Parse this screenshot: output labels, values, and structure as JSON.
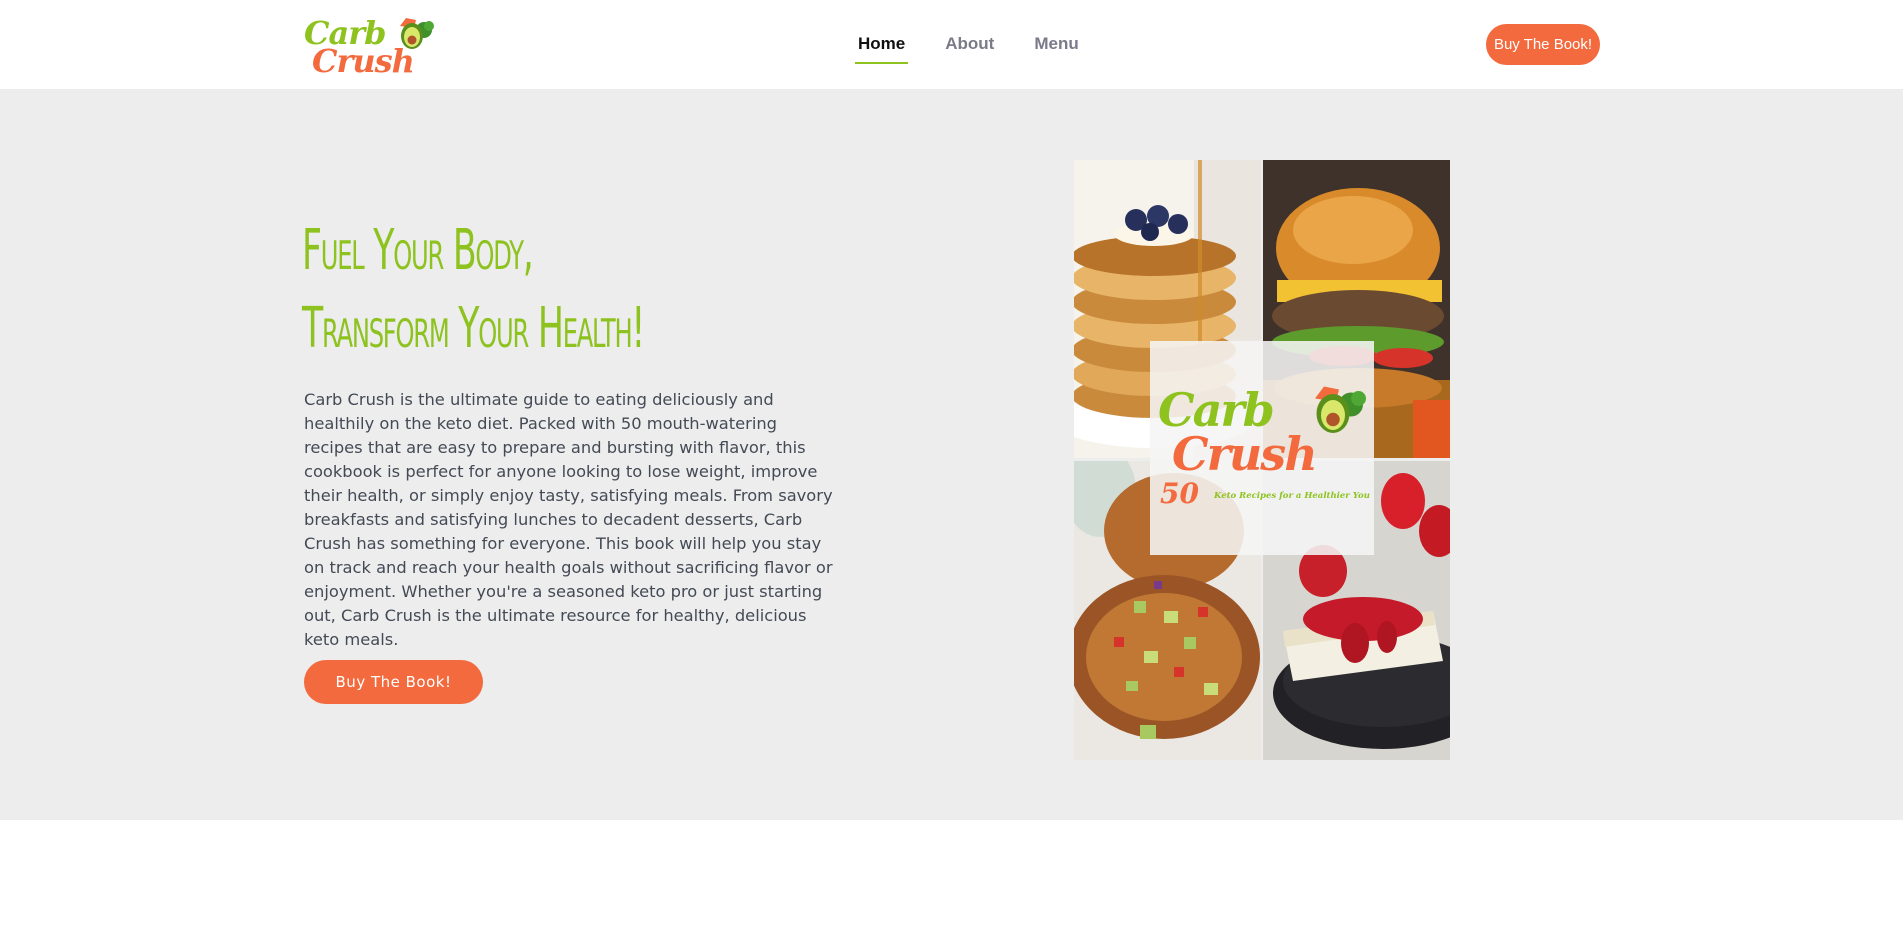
{
  "header": {
    "logo": {
      "line1": "Carb",
      "line2": "Crush",
      "icon": "avocado-icon"
    },
    "nav": [
      {
        "label": "Home",
        "active": true
      },
      {
        "label": "About",
        "active": false
      },
      {
        "label": "Menu",
        "active": false
      }
    ],
    "cta_label": "Buy The Book!"
  },
  "hero": {
    "headline_line1": "Fuel Your Body,",
    "headline_line2": "Transform Your Health!",
    "description": "Carb Crush is the ultimate guide to eating deliciously and healthily on the keto diet. Packed with 50 mouth-watering recipes that are easy to prepare and bursting with flavor, this cookbook is perfect for anyone looking to lose weight, improve their health, or simply enjoy tasty, satisfying meals. From savory breakfasts and satisfying lunches to decadent desserts, Carb Crush has something for everyone. This book will help you stay on track and reach your health goals without sacrificing flavor or enjoyment. Whether you're a seasoned keto pro or just starting out, Carb Crush is the ultimate resource for healthy, delicious keto meals.",
    "cta_label": "Buy The Book!",
    "cover": {
      "title_line1": "Carb",
      "title_line2": "Crush",
      "number": "50",
      "subtitle": "Keto Recipes for a Healthier You",
      "photos": [
        "pancakes-image",
        "burger-image",
        "chicken-salsa-image",
        "cheesecake-image"
      ]
    }
  },
  "colors": {
    "brand_green": "#8dc21f",
    "brand_orange": "#f26a3d",
    "hero_bg": "#ededed"
  }
}
